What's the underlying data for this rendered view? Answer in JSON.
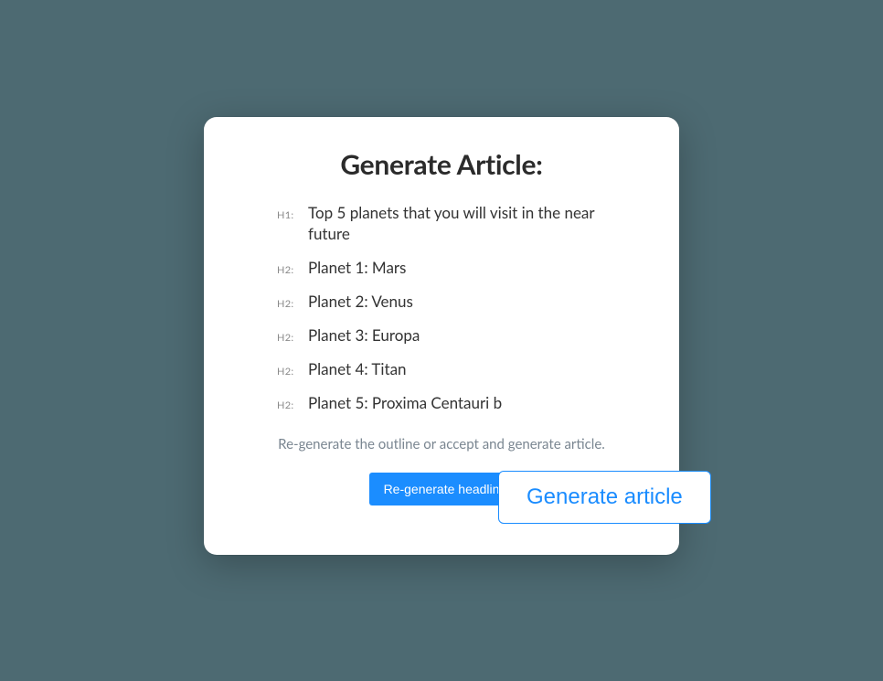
{
  "modal": {
    "title": "Generate Article:",
    "outline": [
      {
        "level": "H1:",
        "text": "Top 5 planets that you will visit in the near future"
      },
      {
        "level": "H2:",
        "text": "Planet 1: Mars"
      },
      {
        "level": "H2:",
        "text": "Planet 2: Venus"
      },
      {
        "level": "H2:",
        "text": "Planet 3: Europa"
      },
      {
        "level": "H2:",
        "text": "Planet 4: Titan"
      },
      {
        "level": "H2:",
        "text": "Planet 5: Proxima Centauri b"
      }
    ],
    "hint": "Re-generate the outline or accept and generate article.",
    "actions": {
      "regenerate_label": "Re-generate headlin",
      "generate_label": "Generate article"
    }
  }
}
